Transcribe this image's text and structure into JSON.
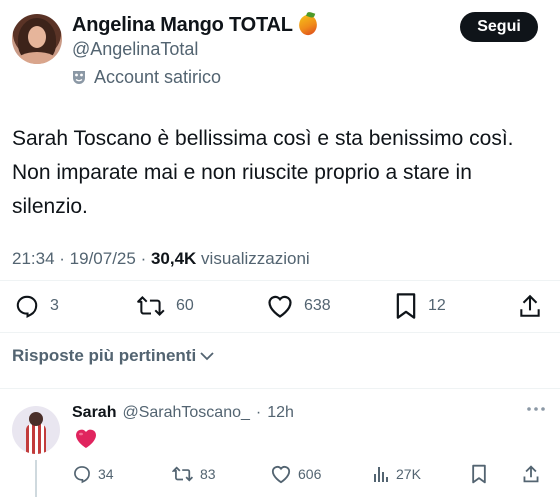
{
  "tweet": {
    "display_name": "Angelina Mango TOTAL",
    "name_emoji_icon": "mango-icon",
    "handle": "@AngelinaTotal",
    "label": "Account satirico",
    "label_icon": "theater-mask-icon",
    "follow_label": "Segui",
    "text": "Sarah Toscano è bellissima così e sta benissimo così. Non imparate mai e non riuscite proprio a stare in silenzio.",
    "time": "21:34",
    "sep1": " · ",
    "date": "19/07/25",
    "sep2": " · ",
    "views": "30,4K",
    "views_label": " visualizzazioni",
    "stats": {
      "replies": "3",
      "reposts": "60",
      "likes": "638",
      "bookmarks": "12"
    }
  },
  "replies_sort": {
    "label": "Risposte più pertinenti"
  },
  "reply": {
    "name": "Sarah",
    "handle": "@SarahToscano_",
    "sep": "·",
    "time": "12h",
    "content_emoji": "red-heart-icon",
    "stats": {
      "replies": "34",
      "reposts": "83",
      "likes": "606",
      "views": "27K"
    }
  },
  "colors": {
    "text_primary": "#0f1419",
    "text_secondary": "#536471",
    "follow_bg": "#0f1419",
    "divider": "#eff3f4"
  }
}
